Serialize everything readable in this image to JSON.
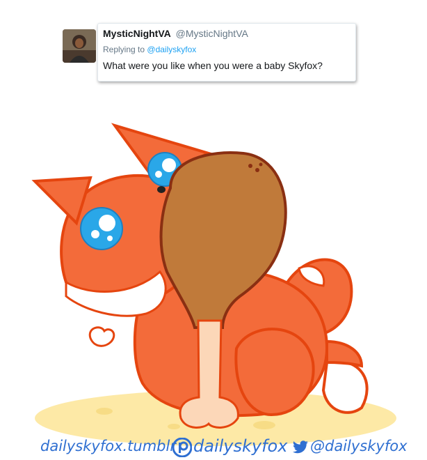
{
  "tweet": {
    "display_name": "MysticNightVA",
    "handle": "@MysticNightVA",
    "replying_prefix": "Replying to",
    "replying_to": "@dailyskyfox",
    "text": "What were you like when you were a baby Skyfox?"
  },
  "illustration": {
    "subject": "baby fox holding drumstick"
  },
  "footer": {
    "tumblr": "dailyskyfox.tumblr",
    "patreon": "dailyskyfox",
    "twitter": "@dailyskyfox"
  },
  "colors": {
    "fox_orange": "#f36b3a",
    "fox_outline": "#e5450f",
    "drumstick": "#c07a3a",
    "drumstick_outline": "#8a2f12",
    "bone": "#fcd7b8",
    "ground": "#fde9a6",
    "credit_blue": "#2f6fd1",
    "link_blue": "#1da1f2"
  },
  "icons": [
    "patreon-icon",
    "twitter-bird-icon"
  ]
}
